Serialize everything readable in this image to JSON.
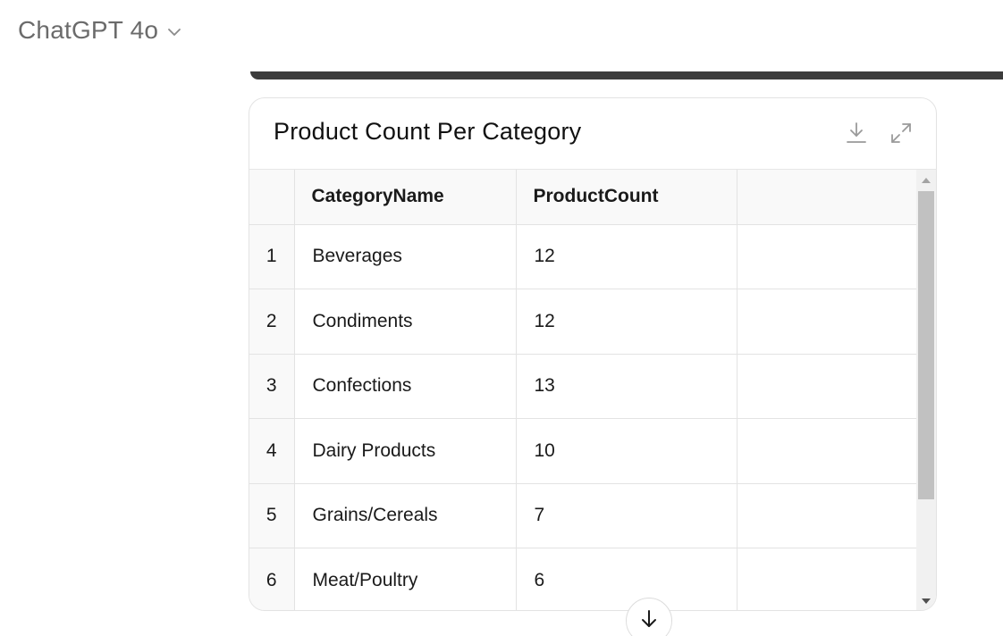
{
  "header": {
    "model_title": "ChatGPT 4o",
    "chevron_icon": "chevron-down-icon"
  },
  "card": {
    "title": "Product Count Per Category",
    "download_icon": "download-icon",
    "expand_icon": "expand-icon"
  },
  "table": {
    "columns": [
      "",
      "CategoryName",
      "ProductCount",
      ""
    ],
    "rows": [
      {
        "index": "1",
        "category": "Beverages",
        "count": "12"
      },
      {
        "index": "2",
        "category": "Condiments",
        "count": "12"
      },
      {
        "index": "3",
        "category": "Confections",
        "count": "13"
      },
      {
        "index": "4",
        "category": "Dairy Products",
        "count": "10"
      },
      {
        "index": "5",
        "category": "Grains/Cereals",
        "count": "7"
      },
      {
        "index": "6",
        "category": "Meat/Poultry",
        "count": "6"
      }
    ]
  },
  "scroll_to_bottom_icon": "arrow-down-icon",
  "colors": {
    "model_title": "#6b6b6b",
    "dark_bar": "#3c3c3c",
    "header_cell_bg": "#f9f9f9",
    "border": "#e3e3e3",
    "scroll_thumb": "#c1c1c1"
  }
}
